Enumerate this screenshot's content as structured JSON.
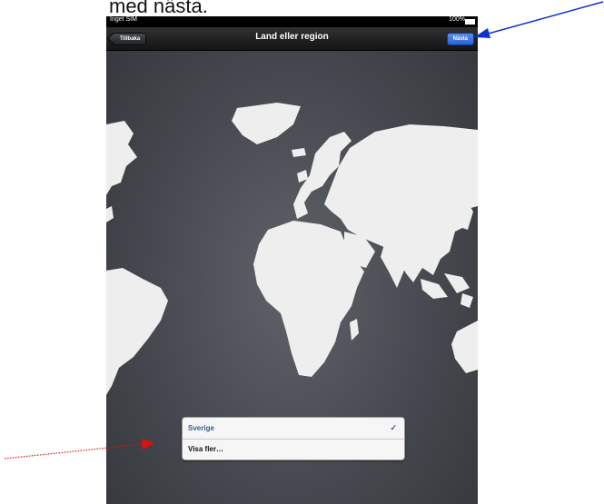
{
  "doc": {
    "partial_text": "med nästa."
  },
  "status_bar": {
    "carrier": "Inget SIM",
    "battery": "100%"
  },
  "nav": {
    "title": "Land eller region",
    "back_label": "Tillbaka",
    "next_label": "Nästa"
  },
  "picker": {
    "items": [
      {
        "label": "Sverige",
        "selected": true,
        "check": "✓"
      },
      {
        "label": "Visa fler…",
        "selected": false
      }
    ]
  },
  "colors": {
    "accent_blue": "#2a62d8",
    "annotation_blue": "#1030d0",
    "annotation_red": "#e01010",
    "selected_text": "#3b5a8e"
  },
  "icons": [
    "battery-icon",
    "back-arrow-icon",
    "world-map",
    "check-icon",
    "arrow-annotation"
  ]
}
